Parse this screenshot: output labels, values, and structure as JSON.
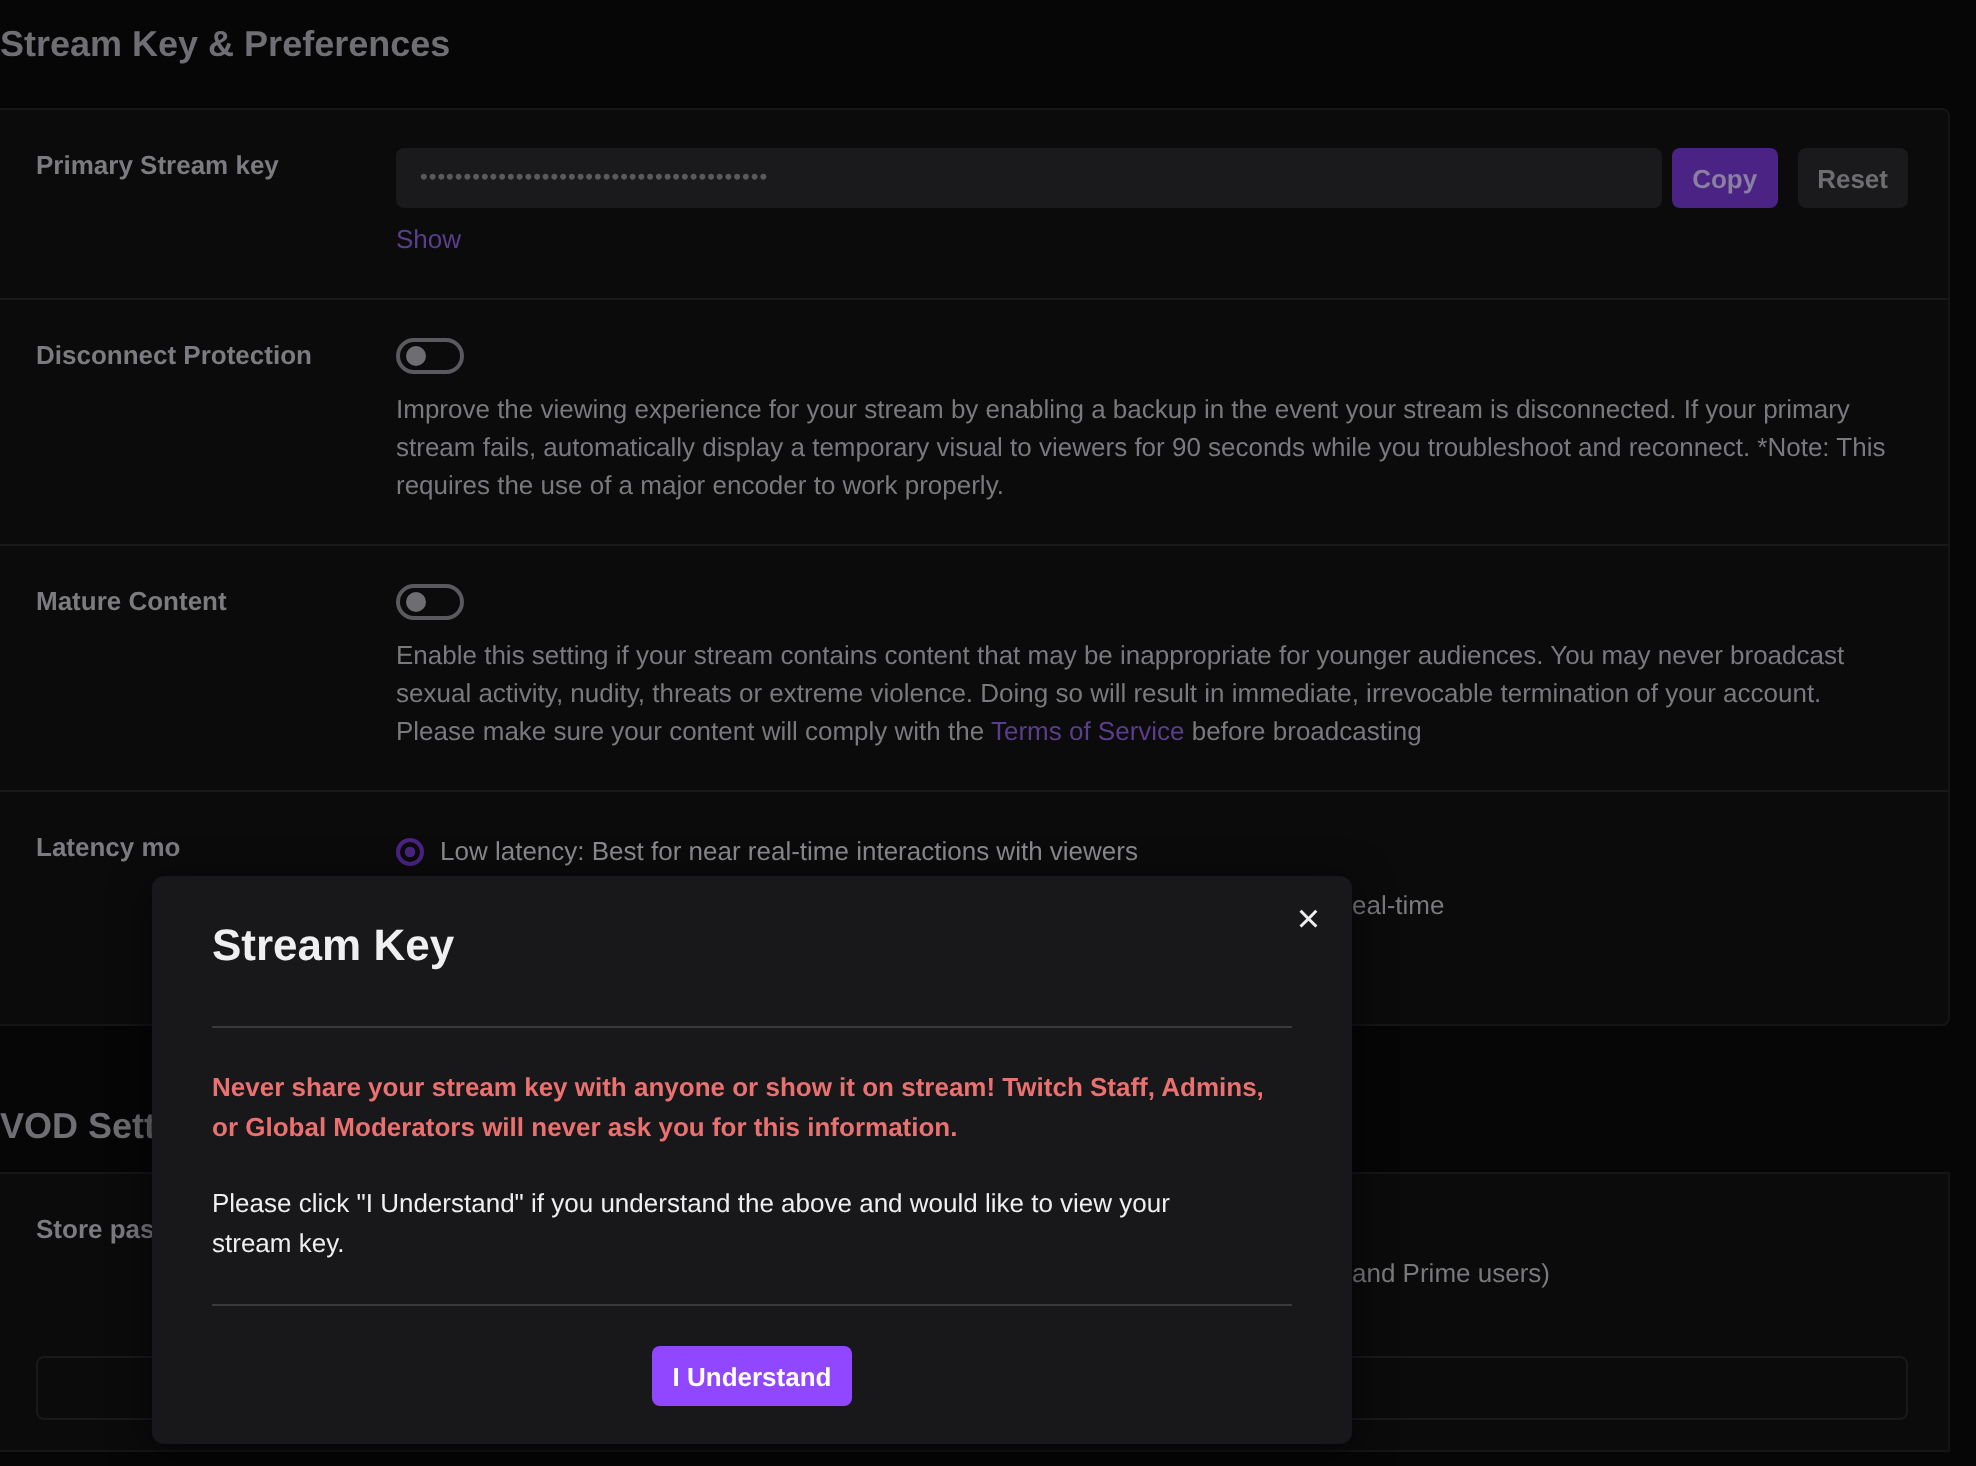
{
  "page": {
    "title": "Stream Key & Preferences"
  },
  "settings": [
    {
      "kind": "key",
      "label": "Primary Stream key",
      "value": "••••••••••••••••••••••••••••••••••••••••",
      "buttons": [
        {
          "label": "Copy",
          "primary": true
        },
        {
          "label": "Reset",
          "primary": false
        }
      ],
      "link": "Show"
    },
    {
      "kind": "toggle",
      "label": "Disconnect Protection",
      "on": false,
      "description": "Improve the viewing experience for your stream by enabling a backup in the event your stream is disconnected. If your primary stream fails, automatically display a temporary visual to viewers for 90 seconds while you troubleshoot and reconnect. *Note: This requires the use of a major encoder to work properly."
    },
    {
      "kind": "toggle",
      "label": "Mature Content",
      "on": false,
      "description": "Enable this setting if your stream contains content that may be inappropriate for younger audiences. You may never broadcast sexual activity, nudity, threats or extreme violence. Doing so will result in immediate, irrevocable termination of your account. Please make sure your content will comply with the",
      "link": "Terms of Service",
      "description_end": "before broadcasting"
    },
    {
      "kind": "radio",
      "label": "Latency mo",
      "options": [
        {
          "label": "Low latency: Best for near real-time interactions with viewers",
          "selected": true
        }
      ],
      "partial_text": "eal-time"
    }
  ],
  "vod_section": {
    "title": "VOD Sett",
    "rows": [
      {
        "label": "Store pas",
        "text": "and Prime users)"
      }
    ]
  },
  "modal": {
    "title": "Stream Key",
    "close": "×",
    "warning": "Never share your stream key with anyone or show it on stream! Twitch Staff, Admins, or Global Moderators will never ask you for this information.",
    "message": "Please click \"I Understand\" if you understand the above and would like to view your stream key.",
    "button": "I Understand"
  }
}
